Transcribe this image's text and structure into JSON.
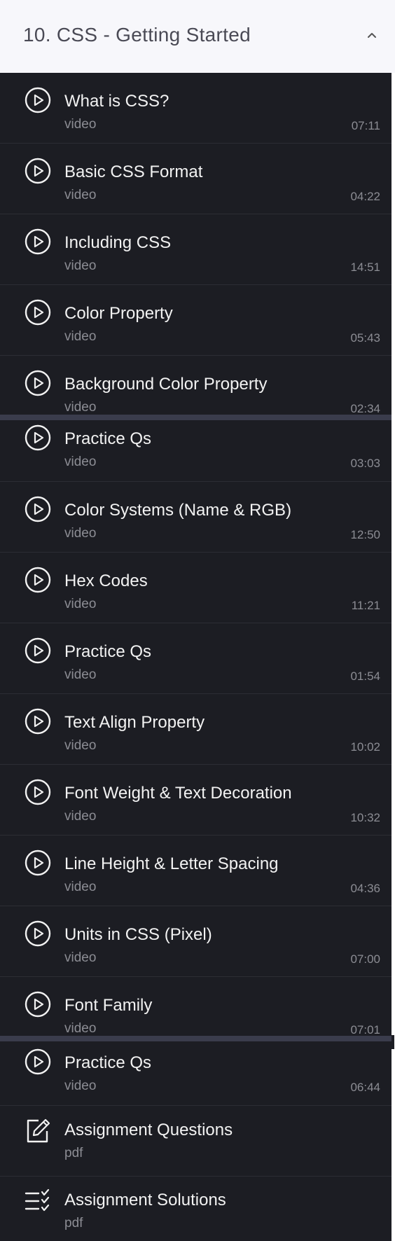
{
  "section": {
    "title": "10. CSS - Getting Started",
    "collapse_icon": "chevron-up-icon"
  },
  "items": [
    {
      "title": "What is CSS?",
      "type": "video",
      "duration": "07:11",
      "icon": "play-circle-icon"
    },
    {
      "title": "Basic CSS Format",
      "type": "video",
      "duration": "04:22",
      "icon": "play-circle-icon"
    },
    {
      "title": "Including CSS",
      "type": "video",
      "duration": "14:51",
      "icon": "play-circle-icon"
    },
    {
      "title": "Color Property",
      "type": "video",
      "duration": "05:43",
      "icon": "play-circle-icon"
    },
    {
      "title": "Background Color Property",
      "type": "video",
      "duration": "02:34",
      "icon": "play-circle-icon"
    },
    {
      "title": "Practice Qs",
      "type": "video",
      "duration": "03:03",
      "icon": "play-circle-icon"
    },
    {
      "title": "Color Systems (Name & RGB)",
      "type": "video",
      "duration": "12:50",
      "icon": "play-circle-icon"
    },
    {
      "title": "Hex Codes",
      "type": "video",
      "duration": "11:21",
      "icon": "play-circle-icon"
    },
    {
      "title": "Practice Qs",
      "type": "video",
      "duration": "01:54",
      "icon": "play-circle-icon"
    },
    {
      "title": "Text Align Property",
      "type": "video",
      "duration": "10:02",
      "icon": "play-circle-icon"
    },
    {
      "title": "Font Weight & Text Decoration",
      "type": "video",
      "duration": "10:32",
      "icon": "play-circle-icon"
    },
    {
      "title": "Line Height & Letter Spacing",
      "type": "video",
      "duration": "04:36",
      "icon": "play-circle-icon"
    },
    {
      "title": "Units in CSS (Pixel)",
      "type": "video",
      "duration": "07:00",
      "icon": "play-circle-icon"
    },
    {
      "title": "Font Family",
      "type": "video",
      "duration": "07:01",
      "icon": "play-circle-icon"
    },
    {
      "title": "Practice Qs",
      "type": "video",
      "duration": "06:44",
      "icon": "play-circle-icon"
    },
    {
      "title": "Assignment Questions",
      "type": "pdf",
      "icon": "edit-document-icon"
    },
    {
      "title": "Assignment Solutions",
      "type": "pdf",
      "icon": "checklist-icon"
    }
  ]
}
